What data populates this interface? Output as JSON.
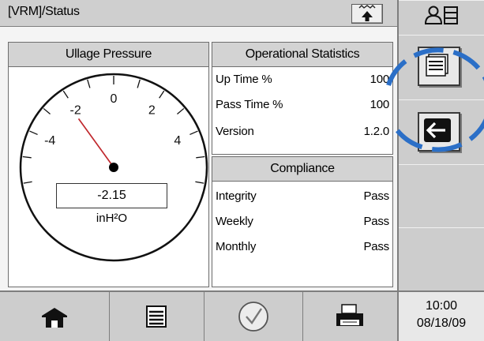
{
  "header": {
    "title": "[VRM]/Status",
    "upload_icon": "upload-icon"
  },
  "ullage": {
    "heading": "Ullage Pressure",
    "value": "-2.15",
    "value_numeric": -2.15,
    "unit": "inH²O",
    "scale_min": -6,
    "scale_max": 6,
    "tick_labels": [
      "-4",
      "-2",
      "0",
      "2",
      "4"
    ]
  },
  "operational": {
    "heading": "Operational Statistics",
    "rows": [
      {
        "label": "Up Time %",
        "value": "100"
      },
      {
        "label": "Pass Time %",
        "value": "100"
      },
      {
        "label": "Version",
        "value": "1.2.0"
      }
    ]
  },
  "compliance": {
    "heading": "Compliance",
    "rows": [
      {
        "label": "Integrity",
        "value": "Pass"
      },
      {
        "label": "Weekly",
        "value": "Pass"
      },
      {
        "label": "Monthly",
        "value": "Pass"
      }
    ]
  },
  "sidebar": {
    "items": [
      {
        "name": "user-list-icon"
      },
      {
        "name": "reports-icon"
      },
      {
        "name": "back-arrow-icon"
      },
      {
        "name": "empty"
      },
      {
        "name": "empty"
      }
    ]
  },
  "footer": {
    "buttons": [
      "home-icon",
      "list-icon",
      "checkmark-icon",
      "printer-icon"
    ],
    "time": "10:00",
    "date": "08/18/09"
  },
  "colors": {
    "annotation": "#2b6fc7",
    "needle": "#c0282d",
    "panel_header": "#d3d3d3"
  }
}
